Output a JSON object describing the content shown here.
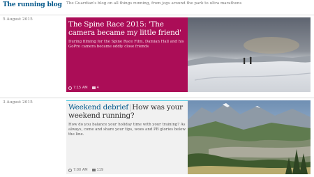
{
  "header": {
    "blog_title": "The running blog",
    "description": "The Guardian's blog on all things running, from jogs around the park to ultra marathons"
  },
  "sections": [
    {
      "date": "5 August 2015",
      "card": {
        "headline": "The Spine Race 2015: 'The camera became my little friend'",
        "standfirst": "During filming for the Spine Race Film, Damian Hall and his GoPro camera became oddly close friends",
        "time": "7:15 AM",
        "comments": "4",
        "image": "snow-hikers-photo"
      }
    },
    {
      "date": "3 August 2015",
      "card": {
        "kicker": "Weekend debrief",
        "headline": "How was your weekend running?",
        "standfirst": "How do you balance your holiday time with your training? As always, come and share your tips, woes and PB glories below the line.",
        "time": "7:00 AM",
        "comments": "119",
        "image": "alpine-valley-photo"
      }
    }
  ],
  "colors": {
    "brand_blue": "#005689",
    "feature_pink": "#ab0d57",
    "kicker_cyan": "#4bc6df"
  }
}
